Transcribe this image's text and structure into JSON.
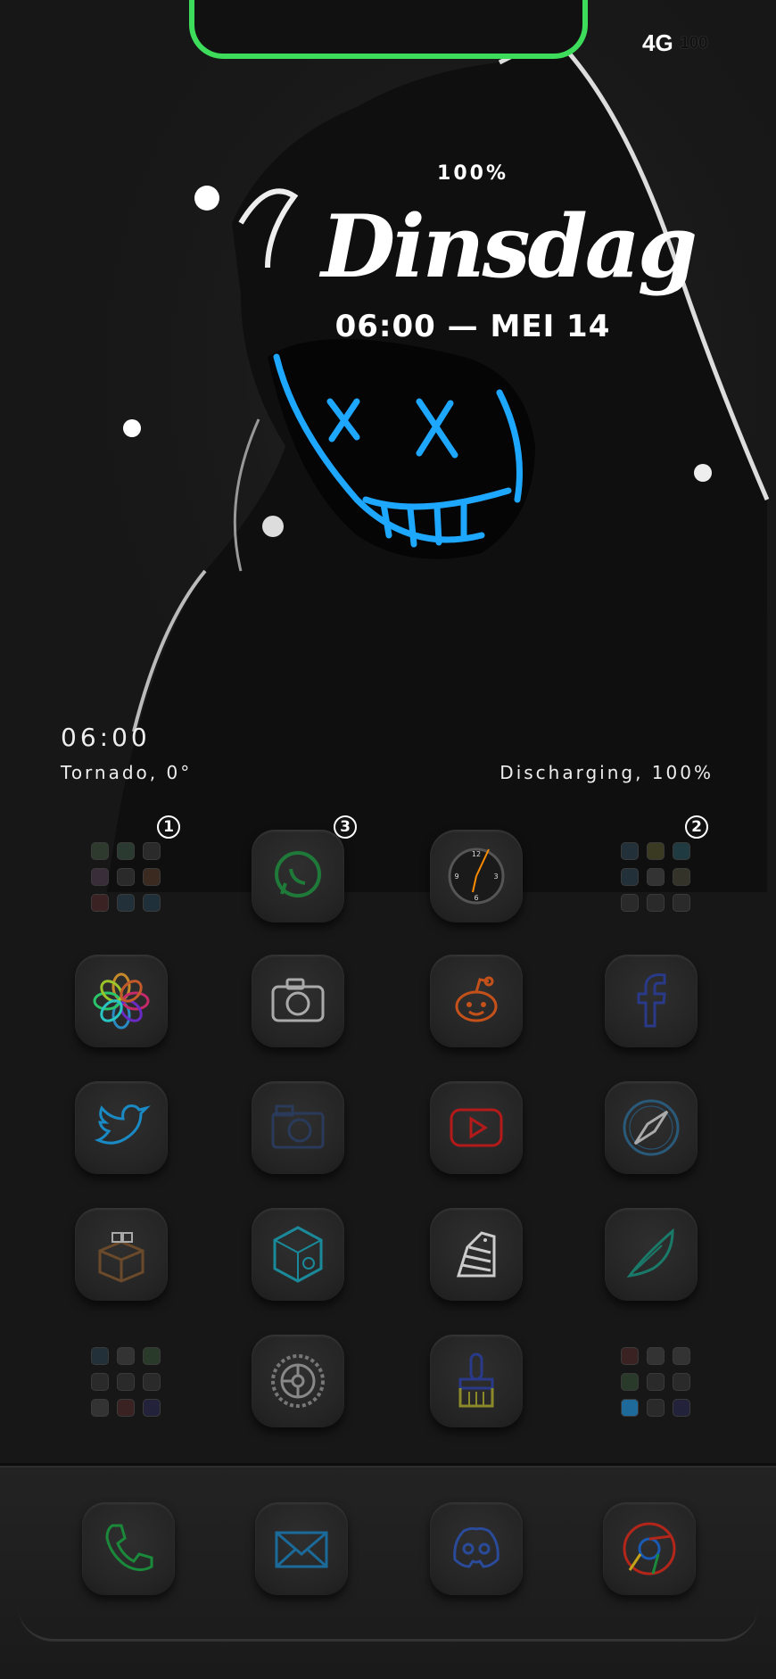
{
  "status_bar": {
    "signal": "4G",
    "battery": "100"
  },
  "lock_widget": {
    "battery_percent": "100%",
    "day_name": "Dinsdag",
    "time_date": "06:00 — MEI 14"
  },
  "info_widget": {
    "time": "06:00",
    "weather": "Tornado, 0°",
    "battery_status": "Discharging, 100%"
  },
  "home_grid": {
    "row1": [
      {
        "name": "folder-1",
        "badge": "1"
      },
      {
        "name": "whatsapp",
        "badge": "3"
      },
      {
        "name": "clock",
        "badge": ""
      },
      {
        "name": "folder-2",
        "badge": "2"
      }
    ],
    "row2": [
      "photos",
      "camera",
      "reddit",
      "facebook"
    ],
    "row3": [
      "twitter",
      "screenshot",
      "youtube",
      "safari"
    ],
    "row4": [
      "cydia",
      "zebra-box",
      "zebra",
      "feather"
    ],
    "row5": [
      "folder-3",
      "settings",
      "paint-brush",
      "folder-4"
    ]
  },
  "dock": [
    "phone",
    "mail",
    "discord",
    "chrome"
  ],
  "colors": {
    "notch_outline": "#3ddc5a",
    "mask_neon": "#1ea7ff",
    "icon_bg": "#262626"
  }
}
